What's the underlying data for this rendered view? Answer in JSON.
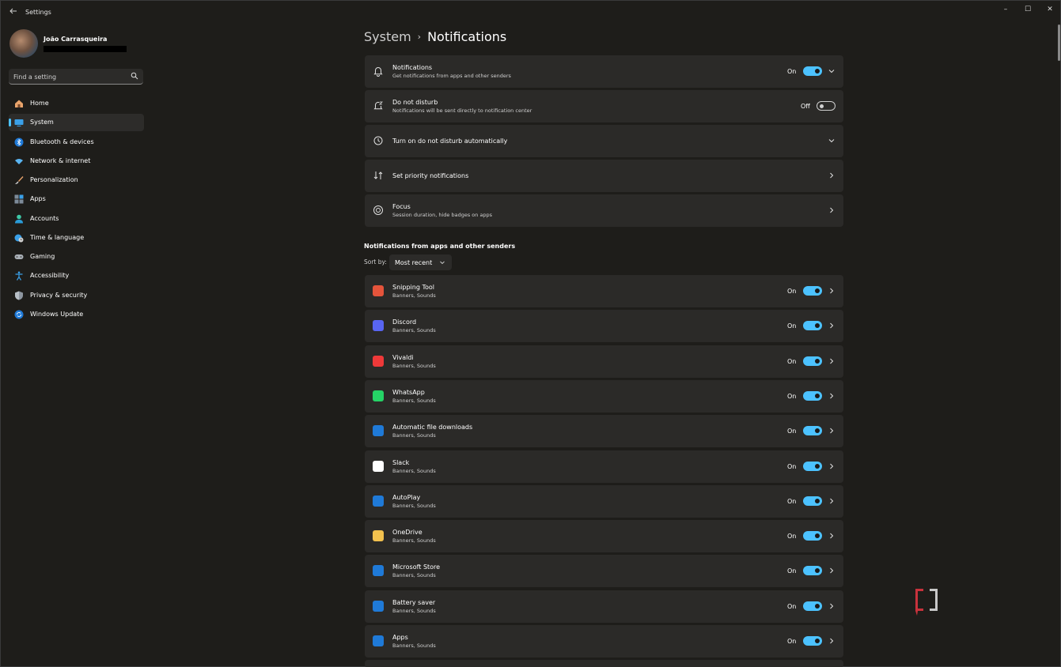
{
  "window": {
    "title": "Settings",
    "controls": {
      "minimize": "–",
      "maximize": "☐",
      "close": "✕"
    }
  },
  "user": {
    "name": "João Carrasqueira"
  },
  "search": {
    "placeholder": "Find a setting"
  },
  "sidebar": {
    "items": [
      {
        "label": "Home",
        "icon": "home-icon",
        "selected": false
      },
      {
        "label": "System",
        "icon": "system-icon",
        "selected": true
      },
      {
        "label": "Bluetooth & devices",
        "icon": "bluetooth-icon",
        "selected": false
      },
      {
        "label": "Network & internet",
        "icon": "wifi-icon",
        "selected": false
      },
      {
        "label": "Personalization",
        "icon": "brush-icon",
        "selected": false
      },
      {
        "label": "Apps",
        "icon": "apps-icon",
        "selected": false
      },
      {
        "label": "Accounts",
        "icon": "accounts-icon",
        "selected": false
      },
      {
        "label": "Time & language",
        "icon": "globe-clock-icon",
        "selected": false
      },
      {
        "label": "Gaming",
        "icon": "gamepad-icon",
        "selected": false
      },
      {
        "label": "Accessibility",
        "icon": "accessibility-icon",
        "selected": false
      },
      {
        "label": "Privacy & security",
        "icon": "shield-icon",
        "selected": false
      },
      {
        "label": "Windows Update",
        "icon": "update-icon",
        "selected": false
      }
    ]
  },
  "breadcrumb": {
    "parent": "System",
    "separator": "›",
    "current": "Notifications"
  },
  "settings": [
    {
      "title": "Notifications",
      "subtitle": "Get notifications from apps and other senders",
      "state": "On",
      "toggle": true,
      "control": "expand"
    },
    {
      "title": "Do not disturb",
      "subtitle": "Notifications will be sent directly to notification center",
      "state": "Off",
      "toggle": false,
      "control": "none"
    },
    {
      "title": "Turn on do not disturb automatically",
      "subtitle": "",
      "control": "expand"
    },
    {
      "title": "Set priority notifications",
      "subtitle": "",
      "control": "navigate"
    },
    {
      "title": "Focus",
      "subtitle": "Session duration, hide badges on apps",
      "control": "navigate"
    }
  ],
  "apps_section": {
    "title": "Notifications from apps and other senders",
    "sort_label": "Sort by:",
    "sort_value": "Most recent"
  },
  "apps": [
    {
      "name": "Snipping Tool",
      "detail": "Banners, Sounds",
      "state": "On",
      "color": "#e5543b"
    },
    {
      "name": "Discord",
      "detail": "Banners, Sounds",
      "state": "On",
      "color": "#5865f2"
    },
    {
      "name": "Vivaldi",
      "detail": "Banners, Sounds",
      "state": "On",
      "color": "#ef3939"
    },
    {
      "name": "WhatsApp",
      "detail": "Banners, Sounds",
      "state": "On",
      "color": "#25d366"
    },
    {
      "name": "Automatic file downloads",
      "detail": "Banners, Sounds",
      "state": "On",
      "color": "#1f7ad8"
    },
    {
      "name": "Slack",
      "detail": "Banners, Sounds",
      "state": "On",
      "color": "#ffffff"
    },
    {
      "name": "AutoPlay",
      "detail": "Banners, Sounds",
      "state": "On",
      "color": "#1f7ad8"
    },
    {
      "name": "OneDrive",
      "detail": "Banners, Sounds",
      "state": "On",
      "color": "#f2c14e"
    },
    {
      "name": "Microsoft Store",
      "detail": "Banners, Sounds",
      "state": "On",
      "color": "#1f7ad8"
    },
    {
      "name": "Battery saver",
      "detail": "Banners, Sounds",
      "state": "On",
      "color": "#1f7ad8"
    },
    {
      "name": "Apps",
      "detail": "Banners, Sounds",
      "state": "On",
      "color": "#1f7ad8"
    }
  ],
  "theme": {
    "accent": "#4cc2ff",
    "card": "#2b2a28",
    "background": "#1e1d1a"
  },
  "watermark": {
    "text": "XDA"
  }
}
